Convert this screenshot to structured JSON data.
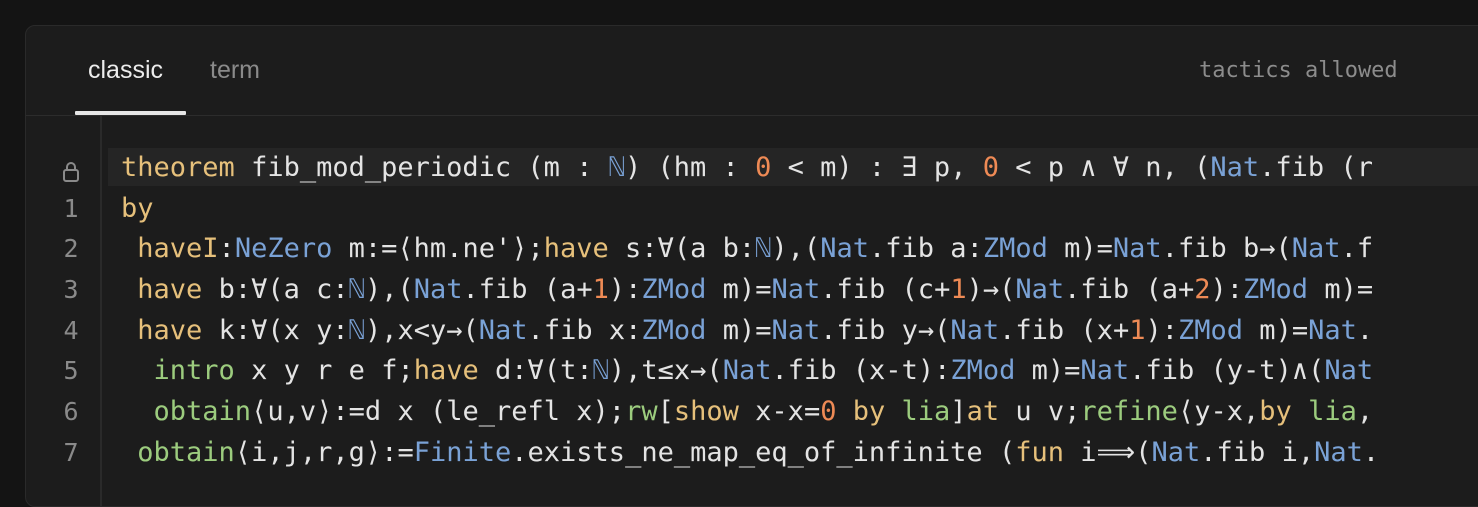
{
  "tabs": [
    {
      "label": "classic",
      "active": true
    },
    {
      "label": "term",
      "active": false
    }
  ],
  "status": {
    "text": "tactics allowed"
  },
  "gutter": {
    "line_numbers": [
      "1",
      "2",
      "3",
      "4",
      "5",
      "6",
      "7"
    ],
    "locked_line_icon": "lock-icon"
  },
  "code": {
    "lines": [
      "theorem fib_mod_periodic (m : ℕ) (hm : 0 < m) : ∃ p, 0 < p ∧ ∀ n, (Nat.fib (r",
      "by",
      " haveI:NeZero m:=⟨hm.ne'⟩;have s:∀(a b:ℕ),(Nat.fib a:ZMod m)=Nat.fib b→(Nat.f",
      " have b:∀(a c:ℕ),(Nat.fib (a+1):ZMod m)=Nat.fib (c+1)→(Nat.fib (a+2):ZMod m)=",
      " have k:∀(x y:ℕ),x<y→(Nat.fib x:ZMod m)=Nat.fib y→(Nat.fib (x+1):ZMod m)=Nat.",
      "  intro x y r e f;have d:∀(t:ℕ),t≤x→(Nat.fib (x-t):ZMod m)=Nat.fib (y-t)∧(Nat",
      "  obtain⟨u,v⟩:=d x (le_refl x);rw[show x-x=0 by lia]at u v;refine⟨y-x,by lia,",
      " obtain⟨i,j,r,g⟩:=Finite.exists_ne_map_eq_of_infinite (fun i⟹(Nat.fib i,Nat."
    ]
  },
  "colors": {
    "keyword": "#e6c07b",
    "type": "#7aa2d6",
    "number": "#ee8a55",
    "tactic": "#9ccc7e",
    "text": "#e4e4e4",
    "background": "#1c1c1c"
  }
}
